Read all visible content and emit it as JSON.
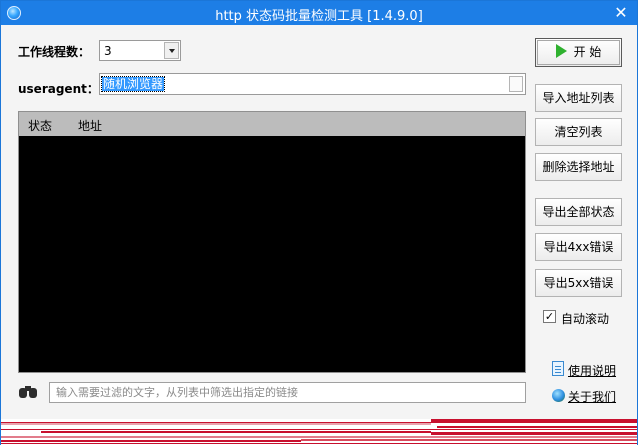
{
  "window": {
    "title": "http 状态码批量检测工具  [1.4.9.0]",
    "close_glyph": "✕"
  },
  "settings": {
    "threads_label": "工作线程数：",
    "threads_value": "3",
    "useragent_label": "useragent：",
    "useragent_value": "随机浏览器"
  },
  "list": {
    "columns": [
      "状态",
      "地址"
    ]
  },
  "buttons": {
    "start": "开 始",
    "import_list": "导入地址列表",
    "clear_list": "清空列表",
    "delete_selected": "删除选择地址",
    "export_all": "导出全部状态",
    "export_4xx": "导出4xx错误",
    "export_5xx": "导出5xx错误"
  },
  "options": {
    "auto_scroll_label": "自动滚动",
    "auto_scroll_checked": true,
    "check_glyph": "✓"
  },
  "links": {
    "help": "使用说明",
    "about": "关于我们"
  },
  "filter": {
    "placeholder": "输入需要过滤的文字，从列表中筛选出指定的链接"
  },
  "colors": {
    "titlebar": "#1d7ee6",
    "list_bg": "#000000",
    "list_header": "#bcbcbc",
    "status_noise": "#c8102e",
    "play_icon": "#2fb12f"
  },
  "icons": {
    "app": "app-globe-icon",
    "close": "close-icon",
    "start": "play-icon",
    "help": "document-icon",
    "about": "globe-icon",
    "filter": "binoculars-icon"
  }
}
